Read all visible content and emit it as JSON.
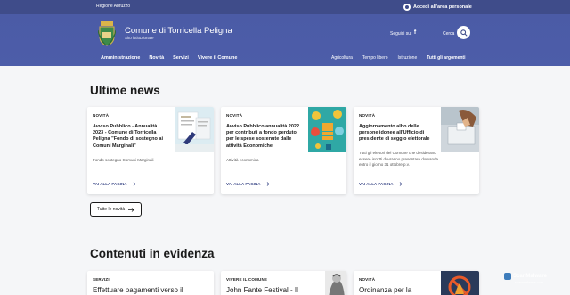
{
  "topbar": {
    "region": "Regione Abruzzo",
    "login_label": "Accedi all'area personale"
  },
  "header": {
    "site_name": "Comune di Torricella Peligna",
    "site_subtitle": "Sito istituzionale",
    "follow_label": "Seguici su:",
    "search_label": "Cerca"
  },
  "nav_main": [
    "Amministrazione",
    "Novità",
    "Servizi",
    "Vivere il Comune"
  ],
  "nav_secondary": [
    "Agricoltura",
    "Tempo libero",
    "Istruzione",
    "Tutti gli argomenti"
  ],
  "news": {
    "title": "Ultime news",
    "cards": [
      {
        "category": "NOVITÀ",
        "title": "Avviso Pubblico - Annualità 2023 - Comune di Torricella Peligna \"Fondo di sostegno ai Comuni Marginali\"",
        "text": "Fondo sostegno Comuni Marginali",
        "link": "VAI ALLA PAGINA"
      },
      {
        "category": "NOVITÀ",
        "title": "Avviso Pubblico annualità 2022 per contributi a fondo perduto per le spese sostenute dalle attività Economiche",
        "text": "Attività economica",
        "link": "VAI ALLA PAGINA"
      },
      {
        "category": "NOVITÀ",
        "title": "Aggiornamento albo delle persone idonee all'Ufficio di presidente di seggio elettorale",
        "text": "Tutti gli elettori del Comune che desiderano essere iscritti dovranno presentare domanda entro il giorno 31 ottobre p.v.",
        "link": "VAI ALLA PAGINA"
      }
    ],
    "all_button": "Tutte le novità"
  },
  "featured": {
    "title": "Contenuti in evidenza",
    "cards": [
      {
        "category": "SERVIZI",
        "title": "Effettuare pagamenti verso il"
      },
      {
        "category": "VIVERE IL COMUNE",
        "title": "John Fante Festival - Il"
      },
      {
        "category": "NOVITÀ",
        "title": "Ordinanza per la"
      }
    ]
  },
  "watermark": {
    "brand": "ScanMalware",
    "sub": "scanmalware.com"
  },
  "colors": {
    "brand": "#3f4c8a",
    "header": "#4b5ba6",
    "background": "#f5f6f8"
  }
}
